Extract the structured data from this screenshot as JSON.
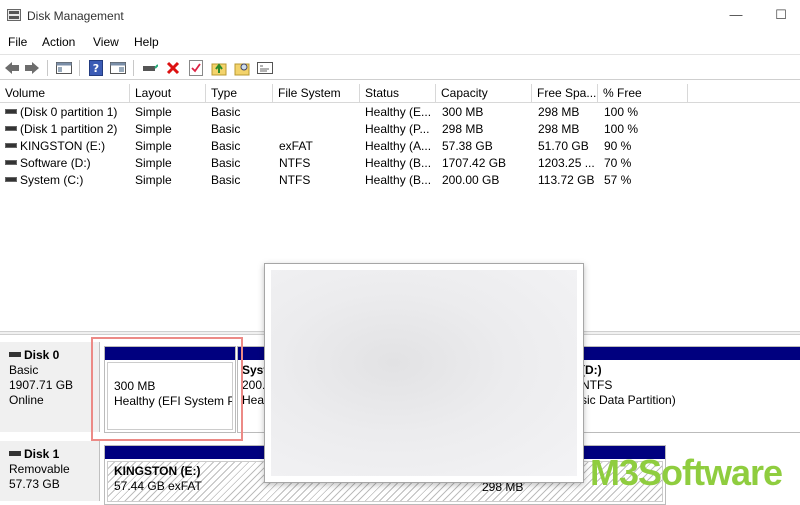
{
  "window": {
    "title": "Disk Management",
    "minimize_glyph": "—",
    "maximize_glyph": "☐"
  },
  "menu": [
    "File",
    "Action",
    "View",
    "Help"
  ],
  "toolbar": {
    "icons": [
      "back-arrow-icon",
      "forward-arrow-icon",
      "show-hide-console-tree-icon",
      "help-icon",
      "properties-icon",
      "connect-drive-icon",
      "delete-icon",
      "check-icon",
      "upload-folder-icon",
      "search-folder-icon",
      "console-window-icon"
    ]
  },
  "volume_list": {
    "columns": [
      "Volume",
      "Layout",
      "Type",
      "File System",
      "Status",
      "Capacity",
      "Free Spa...",
      "% Free"
    ],
    "rows": [
      {
        "volume": "(Disk 0 partition 1)",
        "layout": "Simple",
        "type": "Basic",
        "fs": "",
        "status": "Healthy (E...",
        "capacity": "300 MB",
        "free": "298 MB",
        "pct": "100 %"
      },
      {
        "volume": "(Disk 1 partition 2)",
        "layout": "Simple",
        "type": "Basic",
        "fs": "",
        "status": "Healthy (P...",
        "capacity": "298 MB",
        "free": "298 MB",
        "pct": "100 %"
      },
      {
        "volume": "KINGSTON (E:)",
        "layout": "Simple",
        "type": "Basic",
        "fs": "exFAT",
        "status": "Healthy (A...",
        "capacity": "57.38 GB",
        "free": "51.70 GB",
        "pct": "90 %"
      },
      {
        "volume": "Software (D:)",
        "layout": "Simple",
        "type": "Basic",
        "fs": "NTFS",
        "status": "Healthy (B...",
        "capacity": "1707.42 GB",
        "free": "1203.25 ...",
        "pct": "70 %"
      },
      {
        "volume": "System (C:)",
        "layout": "Simple",
        "type": "Basic",
        "fs": "NTFS",
        "status": "Healthy (B...",
        "capacity": "200.00 GB",
        "free": "113.72 GB",
        "pct": "57 %"
      }
    ]
  },
  "disks": [
    {
      "name": "Disk 0",
      "type": "Basic",
      "size": "1907.71 GB",
      "status": "Online",
      "partitions": [
        {
          "line1": "300 MB",
          "line2": "Healthy (EFI System P"
        },
        {
          "line1": "Syst",
          "line1b": "200.",
          "line2": "Hea"
        },
        {
          "line1": "(D:)",
          "line1b": "NTFS",
          "line2": "sic Data Partition)"
        }
      ]
    },
    {
      "name": "Disk 1",
      "type": "Removable",
      "size": "57.73 GB",
      "partitions": [
        {
          "line1": "KINGSTON  (E:)",
          "line2": "57.44 GB exFAT"
        },
        {
          "line1": "298 MB"
        }
      ]
    }
  ],
  "watermark": {
    "m3": "M3",
    "software": "Software"
  }
}
